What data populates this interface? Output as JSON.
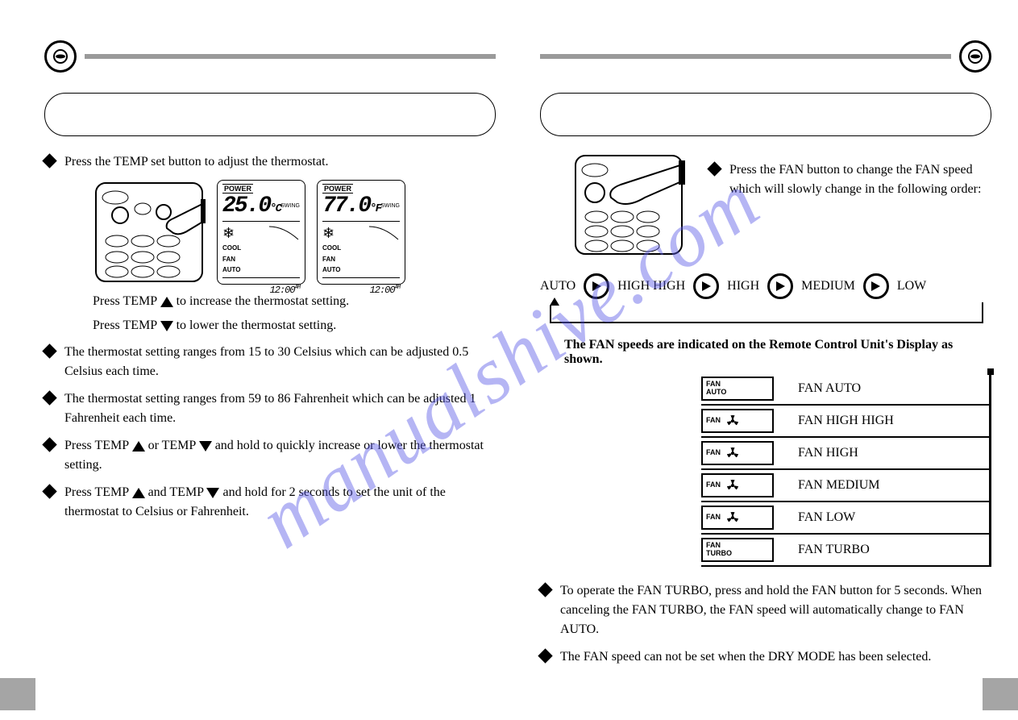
{
  "watermark": "manualshive.com",
  "left": {
    "intro": "Press the TEMP set button to adjust the thermostat.",
    "lcd1": {
      "power": "POWER",
      "temp": "25.0",
      "unit": "°C",
      "swing": "SWING",
      "mode1": "COOL",
      "fan": "FAN",
      "auto": "AUTO",
      "clock": "12:00",
      "ampm": "AM"
    },
    "lcd2": {
      "power": "POWER",
      "temp": "77.0",
      "unit": "°F",
      "swing": "SWING",
      "mode1": "COOL",
      "fan": "FAN",
      "auto": "AUTO",
      "clock": "12:00",
      "ampm": "AM"
    },
    "inc_a": "Press TEMP",
    "inc_b": " to increase the thermostat setting.",
    "dec_a": "Press TEMP",
    "dec_b": " to lower the thermostat setting.",
    "b2": "The thermostat setting ranges from 15 to 30 Celsius which can be adjusted 0.5 Celsius each time.",
    "b3": "The thermostat setting ranges from 59 to 86 Fahrenheit which can be adjusted 1 Fahrenheit each time.",
    "b4_a": "Press TEMP ",
    "b4_mid": " or TEMP ",
    "b4_b": " and hold to quickly increase or lower the thermostat setting.",
    "b5_a": "Press TEMP ",
    "b5_mid": " and TEMP ",
    "b5_b": " and hold for 2 seconds to set the unit of the thermostat to Celsius or Fahrenheit."
  },
  "right": {
    "intro": "Press the FAN button to change the FAN speed which will slowly change in the following order:",
    "flow": [
      "AUTO",
      "HIGH HIGH",
      "HIGH",
      "MEDIUM",
      "LOW"
    ],
    "subhead": "The FAN speeds are indicated on the Remote Control Unit's Display as shown.",
    "rows": [
      {
        "chip_a": "FAN",
        "chip_b": "AUTO",
        "icon": false,
        "label": "FAN  AUTO"
      },
      {
        "chip_a": "FAN",
        "chip_b": "",
        "icon": true,
        "label": "FAN  HIGH HIGH"
      },
      {
        "chip_a": "FAN",
        "chip_b": "",
        "icon": true,
        "label": "FAN  HIGH"
      },
      {
        "chip_a": "FAN",
        "chip_b": "",
        "icon": true,
        "label": "FAN  MEDIUM"
      },
      {
        "chip_a": "FAN",
        "chip_b": "",
        "icon": true,
        "label": "FAN  LOW"
      },
      {
        "chip_a": "FAN",
        "chip_b": "TURBO",
        "icon": false,
        "label": "FAN  TURBO"
      }
    ],
    "b2": "To operate the FAN TURBO, press and hold the FAN button for 5 seconds. When canceling the FAN TURBO, the FAN speed will automatically change to FAN AUTO.",
    "b3": "The FAN speed can not be set when the DRY MODE has been selected."
  }
}
